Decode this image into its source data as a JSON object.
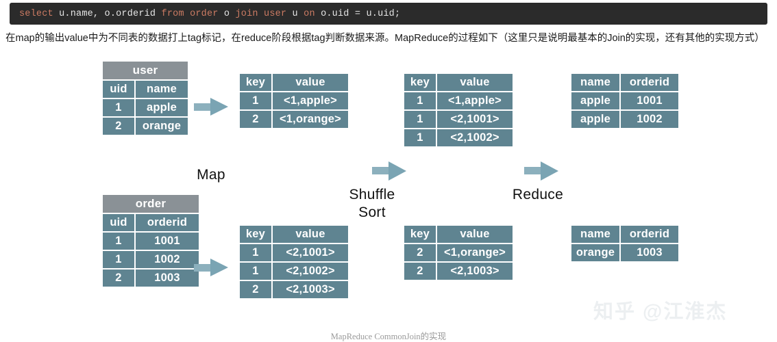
{
  "code_bar": {
    "tokens": [
      {
        "text": "select",
        "type": "keyword"
      },
      {
        "text": " u.name, o.orderid ",
        "type": "plain"
      },
      {
        "text": "from",
        "type": "keyword"
      },
      {
        "text": " ",
        "type": "plain"
      },
      {
        "text": "order",
        "type": "keyword"
      },
      {
        "text": " o ",
        "type": "plain"
      },
      {
        "text": "join",
        "type": "keyword"
      },
      {
        "text": " ",
        "type": "plain"
      },
      {
        "text": "user",
        "type": "keyword"
      },
      {
        "text": " u ",
        "type": "plain"
      },
      {
        "text": "on",
        "type": "keyword"
      },
      {
        "text": " o.uid = u.uid;",
        "type": "plain"
      }
    ],
    "full_text": "select u.name, o.orderid from order o join user u on o.uid = u.uid;",
    "keyword_color": "#cc7b63",
    "text_color": "#e6e6e6",
    "background": "#2b2b2b"
  },
  "description": "在map的输出value中为不同表的数据打上tag标记，在reduce阶段根据tag判断数据来源。MapReduce的过程如下（这里只是说明最基本的Join的实现，还有其他的实现方式）",
  "colors": {
    "cell": "#5f8491",
    "title_cell": "#8a9196",
    "arrow": "#7aa4b3",
    "arrow_tail": "#8cb0bd",
    "watermark": "#eceff1"
  },
  "tables": {
    "user_input": {
      "title": "user",
      "headers": [
        "uid",
        "name"
      ],
      "rows": [
        [
          "1",
          "apple"
        ],
        [
          "2",
          "orange"
        ]
      ]
    },
    "order_input": {
      "title": "order",
      "headers": [
        "uid",
        "orderid"
      ],
      "rows": [
        [
          "1",
          "1001"
        ],
        [
          "1",
          "1002"
        ],
        [
          "2",
          "1003"
        ]
      ]
    },
    "map_out_top": {
      "headers": [
        "key",
        "value"
      ],
      "rows": [
        [
          "1",
          "<1,apple>"
        ],
        [
          "2",
          "<1,orange>"
        ]
      ]
    },
    "map_out_bottom": {
      "headers": [
        "key",
        "value"
      ],
      "rows": [
        [
          "1",
          "<2,1001>"
        ],
        [
          "1",
          "<2,1002>"
        ],
        [
          "2",
          "<2,1003>"
        ]
      ]
    },
    "shuffle_out_top": {
      "headers": [
        "key",
        "value"
      ],
      "rows": [
        [
          "1",
          "<1,apple>"
        ],
        [
          "1",
          "<2,1001>"
        ],
        [
          "1",
          "<2,1002>"
        ]
      ]
    },
    "shuffle_out_bottom": {
      "headers": [
        "key",
        "value"
      ],
      "rows": [
        [
          "2",
          "<1,orange>"
        ],
        [
          "2",
          "<2,1003>"
        ]
      ]
    },
    "reduce_out_top": {
      "headers": [
        "name",
        "orderid"
      ],
      "rows": [
        [
          "apple",
          "1001"
        ],
        [
          "apple",
          "1002"
        ]
      ]
    },
    "reduce_out_bottom": {
      "headers": [
        "name",
        "orderid"
      ],
      "rows": [
        [
          "orange",
          "1003"
        ]
      ]
    }
  },
  "stages": {
    "map": "Map",
    "shuffle_line1": "Shuffle",
    "shuffle_line2": "Sort",
    "reduce": "Reduce"
  },
  "caption": "MapReduce CommonJoin的实现",
  "watermark": "知乎 @江淮杰"
}
